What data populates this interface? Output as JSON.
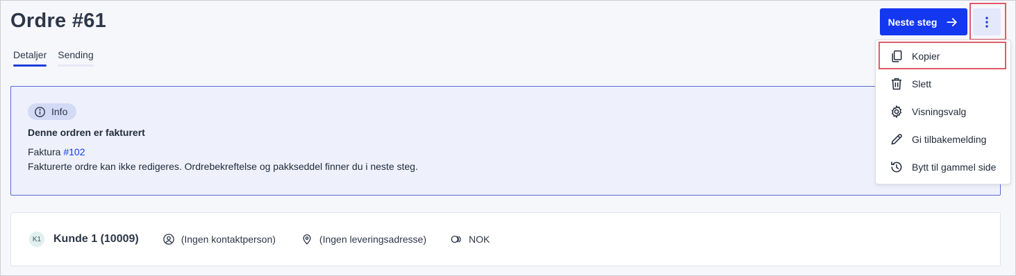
{
  "page": {
    "title": "Ordre #61"
  },
  "tabs": [
    {
      "label": "Detaljer",
      "active": true
    },
    {
      "label": "Sending",
      "active": false
    }
  ],
  "header": {
    "next_button_label": "Neste steg",
    "next_button_icon": "arrow-right-icon",
    "more_button_icon": "more-vertical-icon"
  },
  "info": {
    "pill_label": "Info",
    "pill_icon": "info-circle-icon",
    "heading": "Denne ordren er fakturert",
    "invoice_prefix": "Faktura",
    "invoice_link": "#102",
    "description": "Fakturerte ordre kan ikke redigeres. Ordrebekreftelse og pakkseddel finner du i neste steg."
  },
  "customer": {
    "avatar_initials": "K1",
    "name": "Kunde 1 (10009)",
    "contact": "(Ingen kontaktperson)",
    "contact_icon": "user-circle-icon",
    "address": "(Ingen leveringsadresse)",
    "address_icon": "map-pin-icon",
    "currency": "NOK",
    "currency_icon": "coins-icon"
  },
  "menu": {
    "items": [
      {
        "label": "Kopier",
        "icon": "copy-icon"
      },
      {
        "label": "Slett",
        "icon": "trash-icon"
      },
      {
        "label": "Visningsvalg",
        "icon": "gear-icon"
      },
      {
        "label": "Gi tilbakemelding",
        "icon": "pencil-icon"
      },
      {
        "label": "Bytt til gammel side",
        "icon": "history-icon"
      }
    ]
  },
  "colors": {
    "primary": "#1437f0",
    "info_background": "#eef1fc",
    "info_border": "#5668d8",
    "highlight": "#e05a6a"
  }
}
